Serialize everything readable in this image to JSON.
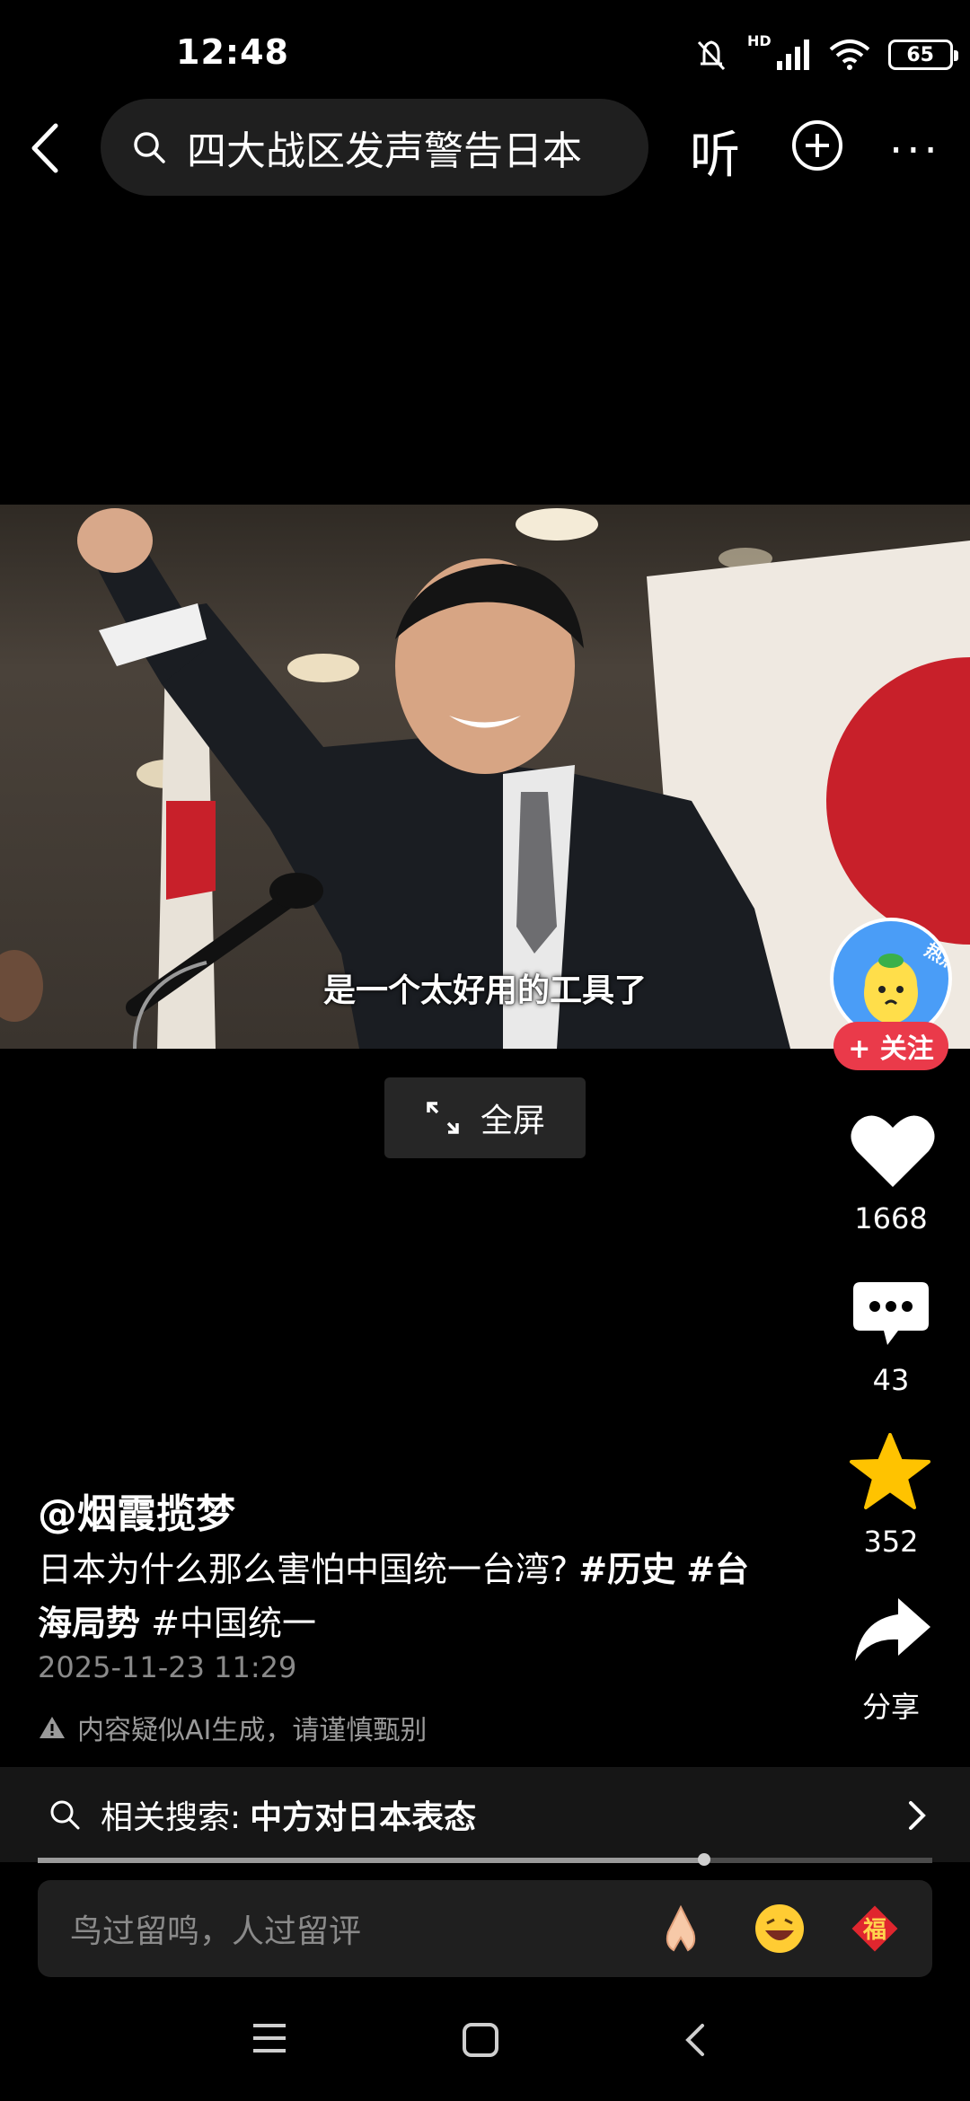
{
  "status": {
    "time": "12:48",
    "battery": "65",
    "network": "HD"
  },
  "search": {
    "query": "四大战区发声警告日本"
  },
  "topbar": {
    "listen": "听",
    "more": "···"
  },
  "video": {
    "subtitle": "是一个太好用的工具了",
    "fullscreen_label": "全屏"
  },
  "author": {
    "follow_label": "+ 关注",
    "name": "@烟霞揽梦",
    "avatar_text": "热点侠"
  },
  "stats": {
    "likes": "1668",
    "comments": "43",
    "favorites": "352",
    "share_label": "分享"
  },
  "post": {
    "caption_text": "日本为什么那么害怕中国统一台湾?",
    "tag_history": "#历史",
    "tag_taiwan": "#台海局势",
    "tag_unification": "#中国统一",
    "date": "2025-11-23 11:29",
    "ai_notice": "内容疑似AI生成，请谨慎甄别"
  },
  "related": {
    "label": "相关搜索:",
    "keyword": "中方对日本表态"
  },
  "playback": {
    "progress": 0.745
  },
  "comment_box": {
    "placeholder": "鸟过留鸣，人过留评",
    "emoji_fu": "福"
  },
  "colors": {
    "accent": "#ea3a4a",
    "favorite": "#ffc300",
    "background": "#000000"
  }
}
